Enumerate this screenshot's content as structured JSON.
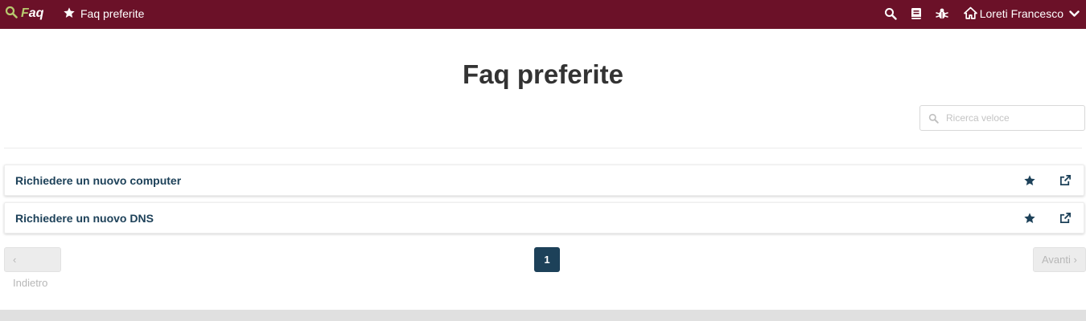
{
  "navbar": {
    "brand_f": "F",
    "brand_rest": "aq",
    "link_label": "Faq preferite",
    "user_name": "Loreti Francesco",
    "icons": [
      "search-icon",
      "star-icon",
      "search-icon",
      "book-icon",
      "bug-icon",
      "home-icon",
      "chevron-down-icon"
    ],
    "colors": {
      "background": "#6b1128",
      "brand_accent": "#b7c96e"
    }
  },
  "page": {
    "title": "Faq preferite"
  },
  "search": {
    "placeholder": "Ricerca veloce",
    "value": ""
  },
  "faq_items": [
    {
      "title": "Richiedere un nuovo computer",
      "icons": [
        "star-icon",
        "external-link-icon"
      ]
    },
    {
      "title": "Richiedere un nuovo DNS",
      "icons": [
        "star-icon",
        "external-link-icon"
      ]
    }
  ],
  "pagination": {
    "prev": "‹ Indietro",
    "current": "1",
    "next": "Avanti ›"
  },
  "colors": {
    "accent": "#1d4159"
  }
}
